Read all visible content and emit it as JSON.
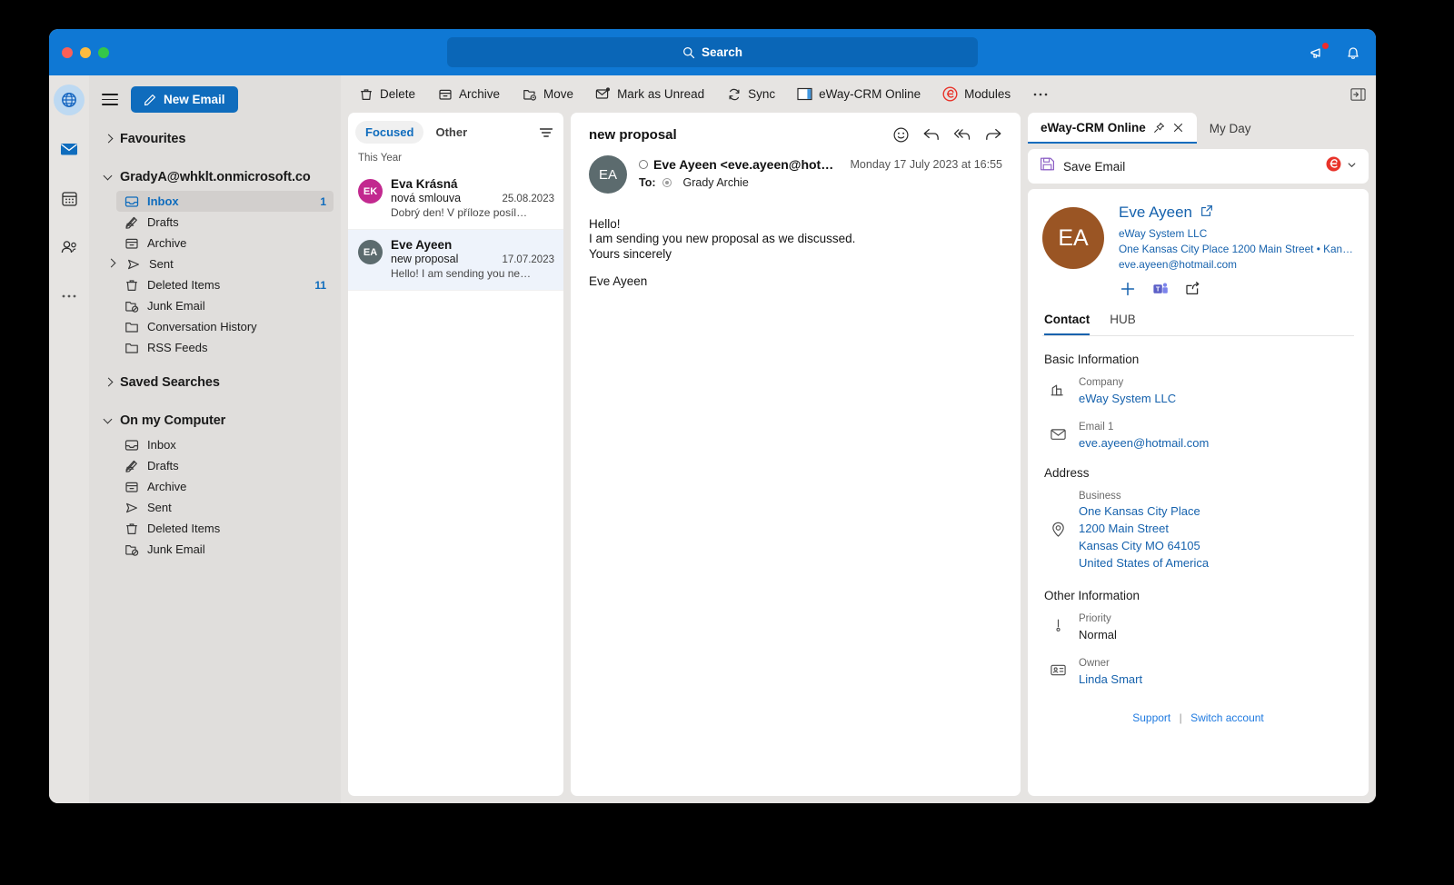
{
  "titlebar": {
    "search_placeholder": "Search",
    "search_icon": "search-icon",
    "send_feedback_icon": "megaphone-icon",
    "notifications_icon": "bell-icon"
  },
  "rail": {
    "items": [
      {
        "name": "globe-icon",
        "label": "eWay-CRM",
        "active": true
      },
      {
        "name": "mail-icon",
        "label": "Mail",
        "active": false
      },
      {
        "name": "calendar-icon",
        "label": "Calendar",
        "active": false
      },
      {
        "name": "people-icon",
        "label": "People",
        "active": false
      },
      {
        "name": "more-icon",
        "label": "More",
        "active": false
      }
    ]
  },
  "sidebar": {
    "new_email_label": "New Email",
    "groups": [
      {
        "label": "Favourites",
        "expanded": false,
        "items": []
      },
      {
        "label": "GradyA@whklt.onmicrosoft.co",
        "expanded": true,
        "items": [
          {
            "label": "Inbox",
            "icon": "inbox-icon",
            "count": "1",
            "selected": true,
            "expandable": false
          },
          {
            "label": "Drafts",
            "icon": "drafts-icon",
            "count": "",
            "selected": false,
            "expandable": false
          },
          {
            "label": "Archive",
            "icon": "archive-icon",
            "count": "",
            "selected": false,
            "expandable": false
          },
          {
            "label": "Sent",
            "icon": "sent-icon",
            "count": "",
            "selected": false,
            "expandable": true
          },
          {
            "label": "Deleted Items",
            "icon": "trash-icon",
            "count": "11",
            "selected": false,
            "expandable": false
          },
          {
            "label": "Junk Email",
            "icon": "junk-icon",
            "count": "",
            "selected": false,
            "expandable": false
          },
          {
            "label": "Conversation History",
            "icon": "folder-icon",
            "count": "",
            "selected": false,
            "expandable": false
          },
          {
            "label": "RSS Feeds",
            "icon": "folder-icon",
            "count": "",
            "selected": false,
            "expandable": false
          }
        ]
      },
      {
        "label": "Saved Searches",
        "expanded": false,
        "items": []
      },
      {
        "label": "On my Computer",
        "expanded": true,
        "items": [
          {
            "label": "Inbox",
            "icon": "inbox-icon",
            "count": "",
            "selected": false,
            "expandable": false
          },
          {
            "label": "Drafts",
            "icon": "drafts-icon",
            "count": "",
            "selected": false,
            "expandable": false
          },
          {
            "label": "Archive",
            "icon": "archive-icon",
            "count": "",
            "selected": false,
            "expandable": false
          },
          {
            "label": "Sent",
            "icon": "sent-icon",
            "count": "",
            "selected": false,
            "expandable": false
          },
          {
            "label": "Deleted Items",
            "icon": "trash-icon",
            "count": "",
            "selected": false,
            "expandable": false
          },
          {
            "label": "Junk Email",
            "icon": "junk-icon",
            "count": "",
            "selected": false,
            "expandable": false
          }
        ]
      }
    ]
  },
  "toolbar": {
    "delete_label": "Delete",
    "archive_label": "Archive",
    "move_label": "Move",
    "mark_unread_label": "Mark as Unread",
    "sync_label": "Sync",
    "eway_label": "eWay-CRM Online",
    "modules_label": "Modules",
    "overflow_label": "…"
  },
  "message_list": {
    "pivots": [
      {
        "label": "Focused",
        "active": true
      },
      {
        "label": "Other",
        "active": false
      }
    ],
    "filter_icon": "filter-icon",
    "section_label": "This Year",
    "messages": [
      {
        "initials": "EK",
        "avatar_color": "#c2298f",
        "from": "Eva Krásná",
        "subject": "nová smlouva",
        "date": "25.08.2023",
        "preview": "Dobrý den! V příloze posíl…",
        "selected": false
      },
      {
        "initials": "EA",
        "avatar_color": "#5c6b6e",
        "from": "Eve Ayeen",
        "subject": "new proposal",
        "date": "17.07.2023",
        "preview": "Hello! I am sending you ne…",
        "selected": true
      }
    ]
  },
  "reader": {
    "subject": "new proposal",
    "actions": [
      {
        "name": "react-emoji-icon"
      },
      {
        "name": "reply-icon"
      },
      {
        "name": "reply-all-icon"
      },
      {
        "name": "forward-icon"
      }
    ],
    "sender_initials": "EA",
    "sender": "Eve Ayeen <eve.ayeen@hotm…",
    "date": "Monday 17 July 2023 at 16:55",
    "to_label": "To:",
    "to_recipient": "Grady Archie",
    "body_lines": [
      "Hello!",
      "I am sending you new proposal as we discussed.",
      "Yours sincerely"
    ],
    "signature": "Eve Ayeen"
  },
  "crm": {
    "tabs": [
      {
        "label": "eWay-CRM Online",
        "active": true,
        "pin_icon": "pin-icon",
        "close_icon": "close-icon"
      },
      {
        "label": "My Day",
        "active": false
      }
    ],
    "save_email_label": "Save Email",
    "save_icon": "floppy-disk-icon",
    "logo_icon": "eway-logo-icon",
    "dropdown_icon": "chevron-down-icon",
    "contact": {
      "initials": "EA",
      "name": "Eve Ayeen",
      "open_icon": "open-external-icon",
      "lines": [
        "eWay System LLC",
        "One Kansas City Place 1200 Main Street • Kansas …",
        "eve.ayeen@hotmail.com"
      ],
      "actions": [
        {
          "name": "add-icon"
        },
        {
          "name": "teams-icon"
        },
        {
          "name": "share-icon"
        }
      ]
    },
    "sub_tabs": [
      {
        "label": "Contact",
        "active": true
      },
      {
        "label": "HUB",
        "active": false
      }
    ],
    "sections": [
      {
        "title": "Basic Information",
        "fields": [
          {
            "icon": "company-icon",
            "label": "Company",
            "values": [
              "eWay System LLC"
            ],
            "link": true
          },
          {
            "icon": "envelope-icon",
            "label": "Email 1",
            "values": [
              "eve.ayeen@hotmail.com"
            ],
            "link": true
          }
        ]
      },
      {
        "title": "Address",
        "fields": [
          {
            "icon": "location-pin-icon",
            "label": "Business",
            "values": [
              "One Kansas City Place",
              "1200 Main Street",
              "Kansas City MO 64105",
              "United States of America"
            ],
            "link": true
          }
        ]
      },
      {
        "title": "Other Information",
        "fields": [
          {
            "icon": "priority-icon",
            "label": "Priority",
            "values": [
              "Normal"
            ],
            "link": false
          },
          {
            "icon": "contact-card-icon",
            "label": "Owner",
            "values": [
              "Linda Smart"
            ],
            "link": true
          }
        ]
      }
    ],
    "footer": {
      "support_label": "Support",
      "separator": "|",
      "switch_account_label": "Switch account"
    }
  },
  "colors": {
    "accent": "#0f6cbd",
    "titlebar": "#0f78d4",
    "link": "#1662ad",
    "eway_red": "#e8332a"
  }
}
